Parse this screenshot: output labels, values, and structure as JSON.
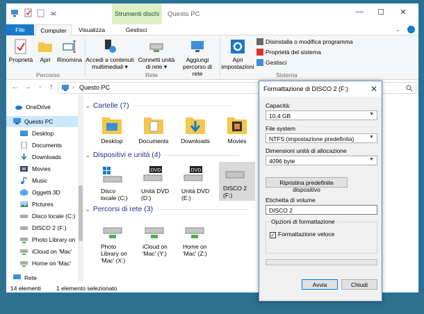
{
  "window": {
    "title": "Questo PC",
    "context_tab": "Strumenti dischi",
    "controls": {
      "minimize": "—",
      "maximize": "☐",
      "close": "✕"
    }
  },
  "tabs": [
    "File",
    "Computer",
    "Visualizza",
    "Gestisci"
  ],
  "ribbon": {
    "groups": [
      {
        "label": "Percorso",
        "buttons": [
          "Proprietà",
          "Apri",
          "Rinomina"
        ]
      },
      {
        "label": "Rete",
        "buttons": [
          "Accedi a contenuti multimediali ▾",
          "Connetti unità di rete ▾",
          "Aggiungi percorso di rete"
        ]
      },
      {
        "label": "Sistema",
        "buttons": [
          "Apri impostazioni"
        ],
        "small": [
          "Disinstalla o modifica programma",
          "Proprietà del sistema",
          "Gestisci"
        ]
      }
    ]
  },
  "address": {
    "path": "Questo PC",
    "separator": "›"
  },
  "nav": {
    "items": [
      "OneDrive",
      "Questo PC",
      "Desktop",
      "Documents",
      "Downloads",
      "Movies",
      "Music",
      "Oggetti 3D",
      "Pictures",
      "Disco locale (C:)",
      "DISCO 2 (F:)",
      "Photo Library on",
      "iCloud on 'Mac'",
      "Home on 'Mac'",
      "Rete"
    ]
  },
  "sections": {
    "folders": {
      "title": "Cartelle (7)",
      "items": [
        "Desktop",
        "Documents",
        "Downloads",
        "Movies"
      ]
    },
    "drives": {
      "title": "Dispositivi e unità (4)",
      "items": [
        {
          "l1": "Disco",
          "l2": "locale (C:)"
        },
        {
          "l1": "Unità DVD",
          "l2": "(D:)"
        },
        {
          "l1": "Unità DVD",
          "l2": "(E:)"
        },
        {
          "l1": "DISCO 2",
          "l2": "(F:)"
        }
      ],
      "dvd_label": "DVD"
    },
    "network": {
      "title": "Percorsi di rete (3)",
      "items": [
        {
          "l1": "Photo",
          "l2": "Library on",
          "l3": "'Mac' (X:)"
        },
        {
          "l1": "iCloud on",
          "l2": "'Mac' (Y:)",
          "l3": ""
        },
        {
          "l1": "Home on",
          "l2": "'Mac' (Z:)",
          "l3": ""
        }
      ]
    }
  },
  "status": {
    "count": "14 elementi",
    "selected": "1 elemento selezionato"
  },
  "dialog": {
    "title": "Formattazione di DISCO 2 (F:)",
    "capacity_label": "Capacità:",
    "capacity_value": "10,4 GB",
    "fs_label": "File system",
    "fs_value": "NTFS (impostazione predefinita)",
    "alloc_label": "Dimensioni unità di allocazione",
    "alloc_value": "4096 byte",
    "restore_button": "Ripristina predefinite dispositivo",
    "volume_label": "Etichetta di volume",
    "volume_value": "DISCO 2",
    "options_label": "Opzioni di formattazione",
    "quick_label": "Formattazione veloce",
    "quick_checked": "✓",
    "start_button": "Avvia",
    "close_button": "Chiudi",
    "progress": 0
  },
  "colors": {
    "accent": "#1979ca",
    "selection": "#cce8ff",
    "section_title": "#1e3287",
    "context_tab": "#dcefc6",
    "desktop_bg": "#2f6f8f"
  }
}
